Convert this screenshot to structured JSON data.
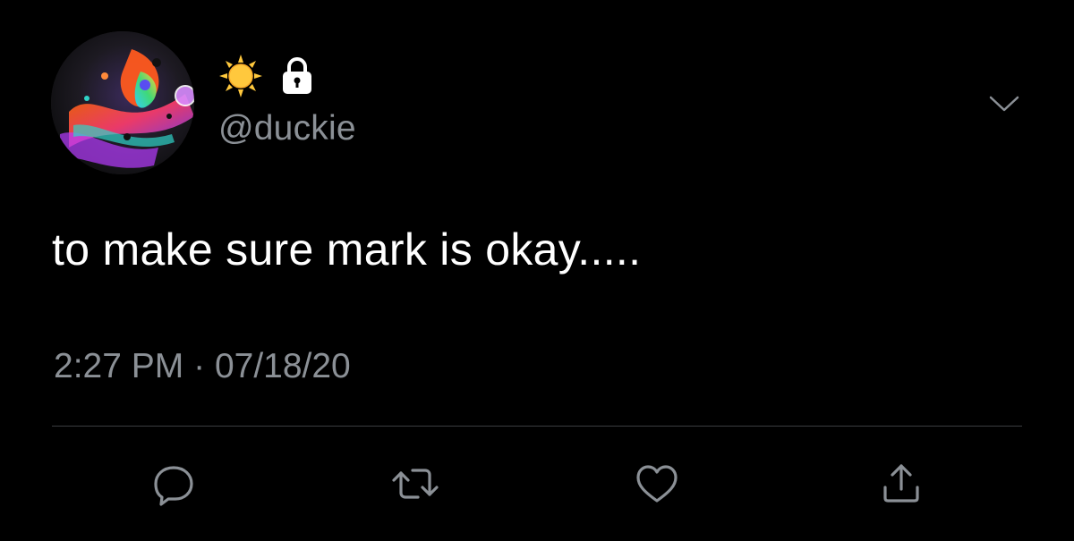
{
  "user": {
    "handle": "@duckie",
    "name_icons": [
      "sun-emoji-icon",
      "lock-icon"
    ]
  },
  "tweet": {
    "text": "to make sure mark is okay.....",
    "time": "2:27 PM",
    "separator": "·",
    "date": "07/18/20"
  },
  "actions": [
    {
      "icon": "reply-icon"
    },
    {
      "icon": "retweet-icon"
    },
    {
      "icon": "like-icon"
    },
    {
      "icon": "share-icon"
    }
  ],
  "colors": {
    "background": "#000000",
    "primary_text": "#ffffff",
    "secondary_text": "#8b9096",
    "divider": "#3a3d41",
    "sun": "#ffc83d"
  }
}
